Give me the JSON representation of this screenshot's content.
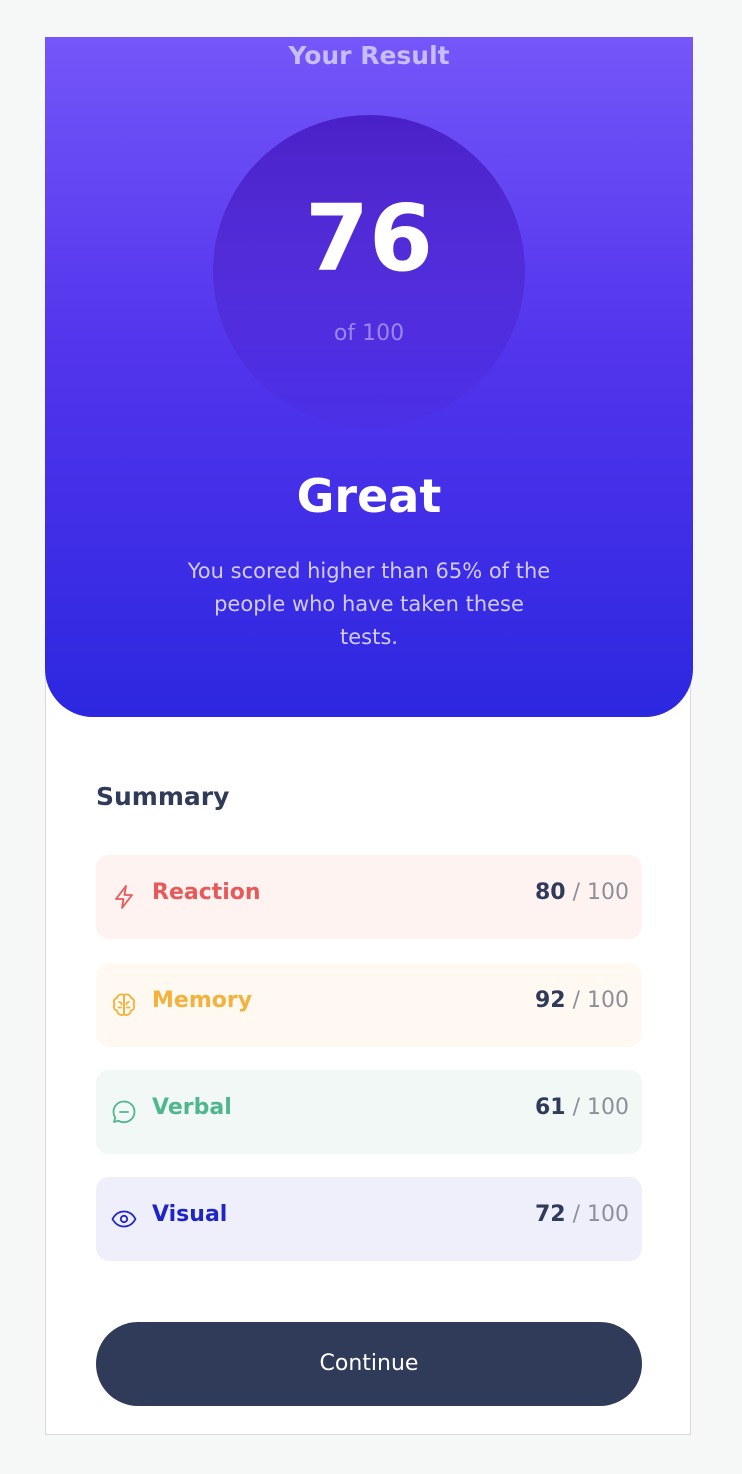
{
  "result": {
    "title": "Your Result",
    "score": "76",
    "score_of": "of 100",
    "rating": "Great",
    "description": "You scored higher than 65% of the people who have taken these tests."
  },
  "summary": {
    "title": "Summary",
    "items": [
      {
        "label": "Reaction",
        "score": "80",
        "max": "/ 100",
        "icon": "lightning-icon",
        "color": "#e85a5a",
        "bg": "#fff3f2"
      },
      {
        "label": "Memory",
        "score": "92",
        "max": "/ 100",
        "icon": "brain-icon",
        "color": "#f4b13c",
        "bg": "#fff9f1"
      },
      {
        "label": "Verbal",
        "score": "61",
        "max": "/ 100",
        "icon": "chat-bubble-icon",
        "color": "#4fb68e",
        "bg": "#f1f8f6"
      },
      {
        "label": "Visual",
        "score": "72",
        "max": "/ 100",
        "icon": "eye-icon",
        "color": "#1f24c8",
        "bg": "#efeffb"
      }
    ]
  },
  "continue_label": "Continue",
  "colors": {
    "gradient_top": "#7456f9",
    "gradient_bottom": "#2d27e0",
    "dark": "#303b59"
  }
}
